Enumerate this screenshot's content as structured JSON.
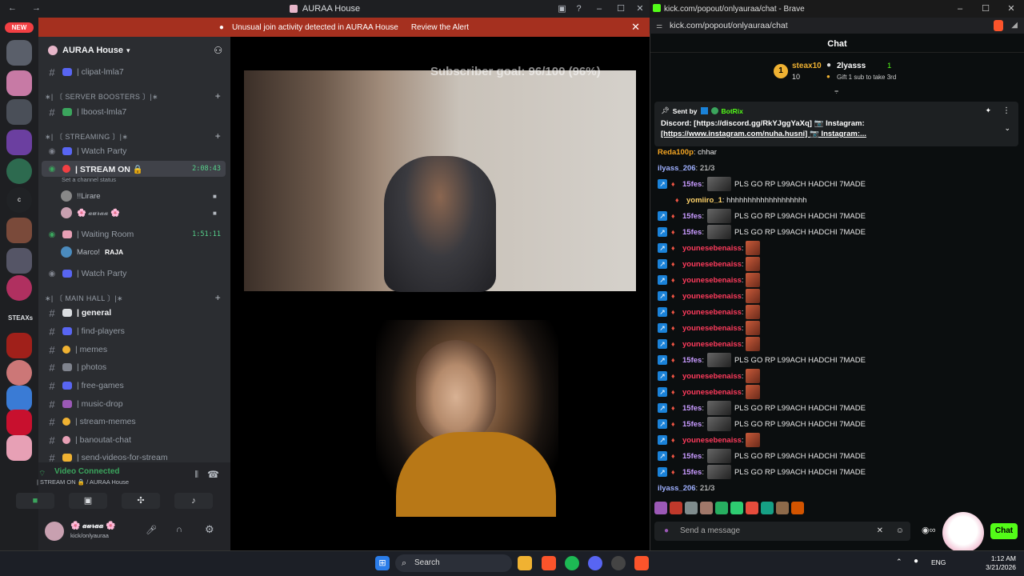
{
  "discord": {
    "title": "AURAA House",
    "new_badge": "NEW",
    "alert_text": "Unusual join activity detected in AURAA House",
    "alert_action": "Review the Alert",
    "guild_name": "AURAA House",
    "server_label": "STEAXs",
    "channels": {
      "clipat": "| clipat-lmla7",
      "cat_boosters": "∗| 〔 SERVER BOOSTERS 〕|∗",
      "lboost": "| lboost-lmla7",
      "cat_streaming": "∗| 〔 STREAMING 〕|∗",
      "watch1": "| Watch Party",
      "stream_on": "| STREAM ON 🔒",
      "stream_time": "2:08:43",
      "stream_status": "Set a channel status",
      "user1": "!!Lirare",
      "user2": "🌸 𝒶𝓊𝓇𝒶𝒶 🌸",
      "waiting": "| Waiting Room",
      "waiting_time": "1:51:11",
      "user3": "Marco!",
      "user3_tag": "RAJA",
      "watch2": "| Watch Party",
      "cat_main": "∗| 〔 MAIN HALL 〕|∗",
      "general": "| general",
      "find_players": "| find-players",
      "memes": "| memes",
      "photos": "| photos",
      "free_games": "| free-games",
      "music_drop": "| music-drop",
      "stream_memes": "| stream-memes",
      "banoutat": "| banoutat-chat",
      "send_videos": "| send-videos-for-stream"
    },
    "voice": {
      "status": "Video Connected",
      "location": "| STREAM ON 🔒 / AURAA House"
    },
    "user": {
      "name": "🌸 𝒶𝓊𝓇𝒶𝒶 🌸",
      "sub": "kick/onlyauraa"
    }
  },
  "stream": {
    "goal": "Subscriber goal: 96/100 (96%)"
  },
  "brave": {
    "title": "kick.com/popout/onlyauraa/chat - Brave",
    "url": "kick.com/popout/onlyauraa/chat",
    "chat_title": "Chat",
    "leader1_name": "steax10",
    "leader1_count": "10",
    "leader2_name": "2lyasss",
    "leader2_count": "1",
    "leader_hint": "Gift 1 sub to take 3rd",
    "pinned_sender": "Sent by",
    "pinned_bot": "BotRix",
    "pinned_line1": "Discord: [https://discord.gg/RkYJggYaXq] 📷 Instagram:",
    "pinned_line2": "[https://www.instagram.com/nuha.husni] 📷 Instagram:...",
    "messages": [
      {
        "user": "Reda100p",
        "text": ": chhar",
        "color": "#f5a623"
      },
      {
        "user": "ilyass_206",
        "text": ": 21/3",
        "color": "#9fb0ff"
      },
      {
        "user": "15fes",
        "text": "PLS GO RP L99ACH HADCHI 7MADE",
        "color": "#c89bff"
      },
      {
        "user": "yomiiro_1",
        "text": ": hhhhhhhhhhhhhhhhhhh",
        "color": "#ffd36a"
      },
      {
        "user": "15fes",
        "text": "PLS GO RP L99ACH HADCHI 7MADE",
        "color": "#c89bff"
      },
      {
        "user": "15fes",
        "text": "PLS GO RP L99ACH HADCHI 7MADE",
        "color": "#c89bff"
      },
      {
        "user": "younesebenaiss",
        "text": ":",
        "color": "#ff3b5c"
      },
      {
        "user": "younesebenaiss",
        "text": ":",
        "color": "#ff3b5c"
      },
      {
        "user": "younesebenaiss",
        "text": ":",
        "color": "#ff3b5c"
      },
      {
        "user": "younesebenaiss",
        "text": ":",
        "color": "#ff3b5c"
      },
      {
        "user": "younesebenaiss",
        "text": ":",
        "color": "#ff3b5c"
      },
      {
        "user": "younesebenaiss",
        "text": ":",
        "color": "#ff3b5c"
      },
      {
        "user": "younesebenaiss",
        "text": ":",
        "color": "#ff3b5c"
      },
      {
        "user": "15fes",
        "text": "PLS GO RP L99ACH HADCHI 7MADE",
        "color": "#c89bff"
      },
      {
        "user": "younesebenaiss",
        "text": ":",
        "color": "#ff3b5c"
      },
      {
        "user": "younesebenaiss",
        "text": ":",
        "color": "#ff3b5c"
      },
      {
        "user": "15fes",
        "text": "PLS GO RP L99ACH HADCHI 7MADE",
        "color": "#c89bff"
      },
      {
        "user": "15fes",
        "text": "PLS GO RP L99ACH HADCHI 7MADE",
        "color": "#c89bff"
      },
      {
        "user": "younesebenaiss",
        "text": ":",
        "color": "#ff3b5c"
      },
      {
        "user": "15fes",
        "text": "PLS GO RP L99ACH HADCHI 7MADE",
        "color": "#c89bff"
      },
      {
        "user": "15fes",
        "text": "PLS GO RP L99ACH HADCHI 7MADE",
        "color": "#c89bff"
      },
      {
        "user": "ilyass_206",
        "text": ": 21/3",
        "color": "#9fb0ff"
      }
    ],
    "input_placeholder": "Send a message",
    "chat_button": "Chat"
  },
  "taskbar": {
    "search": "Search",
    "lang": "ENG",
    "time": "1:12 AM",
    "date": "3/21/2026"
  }
}
